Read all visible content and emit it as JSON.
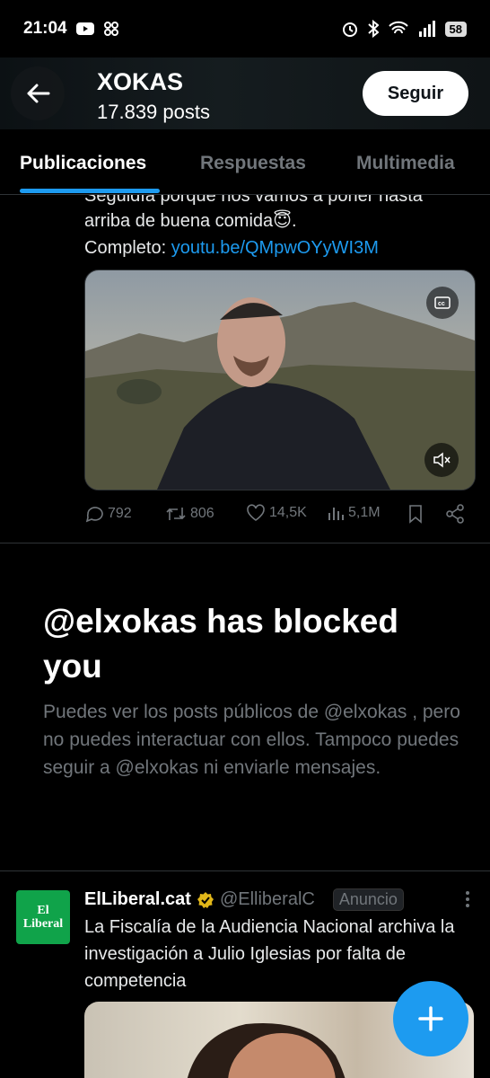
{
  "statusbar": {
    "time": "21:04",
    "battery": "58"
  },
  "header": {
    "title": "XOKAS",
    "subtitle": "17.839 posts",
    "follow_label": "Seguir"
  },
  "tabs": [
    "Publicaciones",
    "Respuestas",
    "Multimedia"
  ],
  "post": {
    "line1": "Seguidía porque nos vamos a poner hasta",
    "line2": "arriba de buena comida😇.",
    "complete_prefix": "Completo: ",
    "link": "youtu.be/QMpwOYyWI3M",
    "stats": {
      "replies": "792",
      "reposts": "806",
      "likes": "14,5K",
      "views": "5,1M"
    }
  },
  "blocked": {
    "title": "@elxokas has blocked you",
    "description": "Puedes ver los posts públicos de @elxokas , pero no puedes interactuar con ellos. Tampoco puedes seguir a @elxokas ni enviarle mensajes."
  },
  "ad": {
    "avatar_line1": "El",
    "avatar_line2": "Liberal",
    "name": "ElLiberal.cat",
    "handle": "@ElliberalC",
    "badge": "Anuncio",
    "text": "La Fiscalía de la Audiencia Nacional archiva la investigación a Julio Iglesias por falta de competencia"
  },
  "colors": {
    "accent": "#1d9bf0",
    "muted": "#71767b",
    "verified": "#e2b719"
  }
}
